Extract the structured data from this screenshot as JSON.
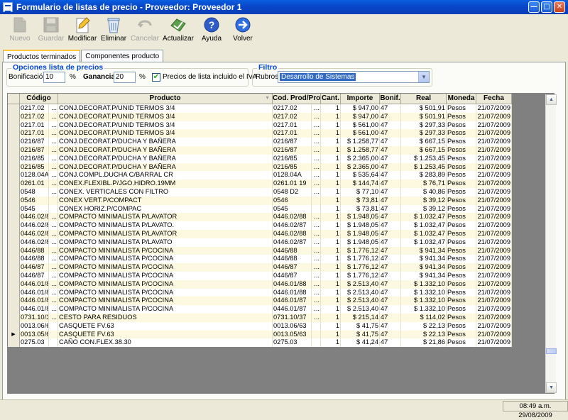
{
  "window": {
    "title": "Formulario de listas de precio - Proveedor: Proveedor 1"
  },
  "toolbar": [
    {
      "label": "Nuevo",
      "icon": "new-doc-icon",
      "enabled": false
    },
    {
      "label": "Guardar",
      "icon": "save-icon",
      "enabled": false
    },
    {
      "label": "Modificar",
      "icon": "pencil-icon",
      "enabled": true
    },
    {
      "label": "Eliminar",
      "icon": "trash-icon",
      "enabled": true
    },
    {
      "label": "Cancelar",
      "icon": "cancel-icon",
      "enabled": false
    },
    {
      "label": "Actualizar",
      "icon": "update-icon",
      "enabled": true
    },
    {
      "label": "Ayuda",
      "icon": "help-icon",
      "enabled": true
    },
    {
      "label": "Volver",
      "icon": "back-arrow-icon",
      "enabled": true
    }
  ],
  "tabs": [
    {
      "label": "Productos terminados",
      "active": true
    },
    {
      "label": "Componentes producto",
      "active": false
    }
  ],
  "options": {
    "legend": "Opciones lista de precios",
    "bonificacion_label": "Bonificación:",
    "bonificacion_value": "10",
    "pct1": "%",
    "ganancia_label": "Ganancia:",
    "ganancia_value": "20",
    "pct2": "%",
    "iva_checked": true,
    "iva_label": "Precios de lista incluido el IVA"
  },
  "filter": {
    "legend": "Filtro",
    "rubros_label": "Rubros:",
    "rubros_value": "Desarrollo de Sistemas"
  },
  "grid": {
    "columns": [
      "Código",
      "Producto",
      "Cod. Prod/Prov",
      "Cant.",
      "Importe",
      "Bonif.",
      "Real",
      "Moneda",
      "Fecha"
    ],
    "rows": [
      [
        "0217.02",
        "...",
        "CONJ.DECORAT.P/UNID TERMOS 3/4",
        "0217.02",
        "...",
        "1",
        "$ 947,00",
        "47",
        "$ 501,91",
        "Pesos",
        "21/07/2009"
      ],
      [
        "0217.02",
        "...",
        "CONJ.DECORAT.P/UNID TERMOS 3/4",
        "0217.02",
        "...",
        "1",
        "$ 947,00",
        "47",
        "$ 501,91",
        "Pesos",
        "21/07/2009"
      ],
      [
        "0217.01",
        "...",
        "CONJ.DECORAT.P/UNID TERMOS 3/4",
        "0217.01",
        "...",
        "1",
        "$ 561,00",
        "47",
        "$ 297,33",
        "Pesos",
        "21/07/2009"
      ],
      [
        "0217.01",
        "...",
        "CONJ.DECORAT.P/UNID TERMOS 3/4",
        "0217.01",
        "...",
        "1",
        "$ 561,00",
        "47",
        "$ 297,33",
        "Pesos",
        "21/07/2009"
      ],
      [
        "0216/87",
        "...",
        "CONJ.DECORAT.P/DUCHA Y BAÑERA",
        "0216/87",
        "...",
        "1",
        "$ 1.258,77",
        "47",
        "$ 667,15",
        "Pesos",
        "21/07/2009"
      ],
      [
        "0216/87",
        "...",
        "CONJ.DECORAT.P/DUCHA Y BAÑERA",
        "0216/87",
        "...",
        "1",
        "$ 1.258,77",
        "47",
        "$ 667,15",
        "Pesos",
        "21/07/2009"
      ],
      [
        "0216/85",
        "...",
        "CONJ.DECORAT.P/DUCHA Y BAÑERA",
        "0216/85",
        "...",
        "1",
        "$ 2.365,00",
        "47",
        "$ 1.253,45",
        "Pesos",
        "21/07/2009"
      ],
      [
        "0216/85",
        "...",
        "CONJ.DECORAT.P/DUCHA Y BAÑERA",
        "0216/85",
        "...",
        "1",
        "$ 2.365,00",
        "47",
        "$ 1.253,45",
        "Pesos",
        "21/07/2009"
      ],
      [
        "0128.04A",
        "...",
        "CONJ.COMPL.DUCHA C/BARRAL  CR",
        "0128.04A",
        "...",
        "1",
        "$ 535,64",
        "47",
        "$ 283,89",
        "Pesos",
        "21/07/2009"
      ],
      [
        "0261.01",
        "...",
        "CONEX.FLEXIBL.P/JGO.HIDRO.19MM",
        "0261.01      19",
        "...",
        "1",
        "$ 144,74",
        "47",
        "$ 76,71",
        "Pesos",
        "21/07/2009"
      ],
      [
        "0548",
        "...",
        "CONEX. VERTICALES CON FILTRO",
        "0548       D2",
        "...",
        "1",
        "$ 77,10",
        "47",
        "$ 40,86",
        "Pesos",
        "21/07/2009"
      ],
      [
        "0546",
        "",
        "CONEX VERT.P/COMPACT",
        "0546",
        "",
        "1",
        "$ 73,81",
        "47",
        "$ 39,12",
        "Pesos",
        "21/07/2009"
      ],
      [
        "0545",
        "",
        "CONEX HORIZ.P/COMPAC",
        "0545",
        "",
        "1",
        "$ 73,81",
        "47",
        "$ 39,12",
        "Pesos",
        "21/07/2009"
      ],
      [
        "0446.02/88",
        "...",
        "COMPACTO MINIMALISTA P/LAVATOR",
        "0446.02/88",
        "...",
        "1",
        "$ 1.948,05",
        "47",
        "$ 1.032,47",
        "Pesos",
        "21/07/2009"
      ],
      [
        "0446.02/87",
        "...",
        "COMPACTO MINIMALISTA P/LAVATO.",
        "0446.02/87",
        "...",
        "1",
        "$ 1.948,05",
        "47",
        "$ 1.032,47",
        "Pesos",
        "21/07/2009"
      ],
      [
        "0446.02/88",
        "...",
        "COMPACTO MINIMALISTA P/LAVATOR",
        "0446.02/88",
        "...",
        "1",
        "$ 1.948,05",
        "47",
        "$ 1.032,47",
        "Pesos",
        "21/07/2009"
      ],
      [
        "0446.02/87",
        "...",
        "COMPACTO MINIMALISTA P/LAVATO",
        "0446.02/87",
        "...",
        "1",
        "$ 1.948,05",
        "47",
        "$ 1.032,47",
        "Pesos",
        "21/07/2009"
      ],
      [
        "0446/88",
        "...",
        "COMPACTO MINIMALISTA P/COCINA",
        "0446/88",
        "...",
        "1",
        "$ 1.776,12",
        "47",
        "$ 941,34",
        "Pesos",
        "21/07/2009"
      ],
      [
        "0446/88",
        "...",
        "COMPACTO MINIMALISTA P/COCINA",
        "0446/88",
        "...",
        "1",
        "$ 1.776,12",
        "47",
        "$ 941,34",
        "Pesos",
        "21/07/2009"
      ],
      [
        "0446/87",
        "...",
        "COMPACTO MINIMALISTA P/COCINA",
        "0446/87",
        "...",
        "1",
        "$ 1.776,12",
        "47",
        "$ 941,34",
        "Pesos",
        "21/07/2009"
      ],
      [
        "0446/87",
        "...",
        "COMPACTO MINIMALISTA P/COCINA",
        "0446/87",
        "...",
        "1",
        "$ 1.776,12",
        "47",
        "$ 941,34",
        "Pesos",
        "21/07/2009"
      ],
      [
        "0446.01/88",
        "...",
        "COMPACTO MINIMALISTA P/COCINA",
        "0446.01/88",
        "...",
        "1",
        "$ 2.513,40",
        "47",
        "$ 1.332,10",
        "Pesos",
        "21/07/2009"
      ],
      [
        "0446.01/88",
        "...",
        "COMPACTO MINIMALISTA P/COCINA",
        "0446.01/88",
        "...",
        "1",
        "$ 2.513,40",
        "47",
        "$ 1.332,10",
        "Pesos",
        "21/07/2009"
      ],
      [
        "0446.01/87",
        "...",
        "COMPACTO MINIMALISTA P/COCINA",
        "0446.01/87",
        "...",
        "1",
        "$ 2.513,40",
        "47",
        "$ 1.332,10",
        "Pesos",
        "21/07/2009"
      ],
      [
        "0446.01/87",
        "...",
        "COMPACTO MINIMALISTA P/COCINA",
        "0446.01/87",
        "...",
        "1",
        "$ 2.513,40",
        "47",
        "$ 1.332,10",
        "Pesos",
        "21/07/2009"
      ],
      [
        "0731.10/37",
        "...",
        "CESTO PARA RESIDUOS",
        "0731.10/37",
        "...",
        "1",
        "$ 215,14",
        "47",
        "$ 114,02",
        "Pesos",
        "21/07/2009"
      ],
      [
        "0013.06/63",
        "",
        "CASQUETE FV.63",
        "0013.06/63",
        "",
        "1",
        "$ 41,75",
        "47",
        "$ 22,13",
        "Pesos",
        "21/07/2009"
      ],
      [
        "0013.05/63",
        "",
        "CASQUETE FV.63",
        "0013.05/63",
        "",
        "1",
        "$ 41,75",
        "47",
        "$ 22,13",
        "Pesos",
        "21/07/2009"
      ],
      [
        "0275.03",
        "",
        "CAÑO CON.FLEX.38.30",
        "0275.03",
        "",
        "1",
        "$ 41,24",
        "47",
        "$ 21,86",
        "Pesos",
        "21/07/2009"
      ]
    ],
    "current_row": 27
  },
  "status": {
    "clock": "08:49 a.m. 29/08/2009"
  }
}
